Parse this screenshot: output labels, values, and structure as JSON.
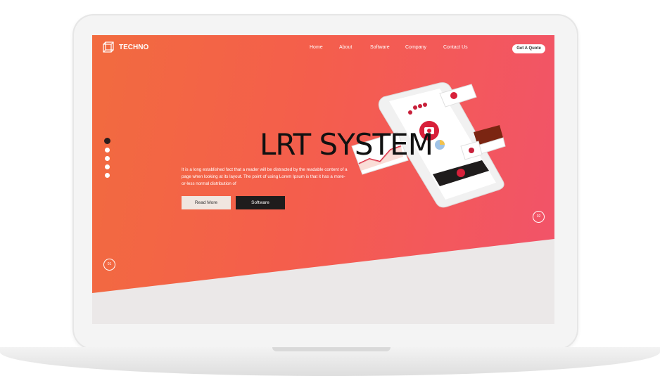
{
  "brand": {
    "name": "TECHNO"
  },
  "nav": {
    "items": [
      "Home",
      "About",
      "Software",
      "Company",
      "Contact Us"
    ],
    "cta_label": "Get A Quote"
  },
  "hero": {
    "title": "LRT SYSTEM",
    "description": "It is a long established fact that a reader will be distracted by the readable content of a page when looking at its layout. The point of using Lorem Ipsum is that it has a more-or-less normal distribution of",
    "primary_button": "Read More",
    "secondary_button": "Software"
  },
  "slider": {
    "dots_count": 5,
    "active_dot": 1,
    "prev_label": "01",
    "next_label": "02"
  },
  "colors": {
    "gradient_start": "#f26b3f",
    "gradient_end": "#f2536a",
    "dark": "#1f1c1c",
    "accent": "#d8203a"
  }
}
